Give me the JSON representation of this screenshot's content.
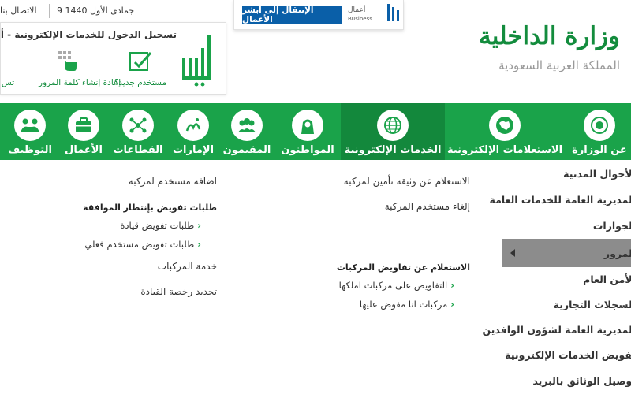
{
  "topbar": {
    "contact": "الاتصال بنا",
    "hijri_date": "9 جمادى الأول 1440"
  },
  "business": {
    "button_label": "الإنتقال إلى أبشر الأعمال",
    "logo_text": "أعمال",
    "logo_sub": "Business"
  },
  "login": {
    "title": "تسجيل الدخول للخدمات الإلكترونية - أبشر",
    "new_user": "مستخدم جديد؟",
    "reset_password": "إعادة إنشاء كلمة المرور",
    "other": "تس"
  },
  "ministry": {
    "name": "وزارة الداخلية",
    "sub": "المملكة العربية السعودية"
  },
  "nav": {
    "items": [
      {
        "label": "عن الوزارة",
        "icon": "emblem-icon"
      },
      {
        "label": "الاستعلامات الإلكترونية",
        "icon": "globe-map-icon"
      },
      {
        "label": "الخدمات الإلكترونية",
        "icon": "globe-icon",
        "active": true
      },
      {
        "label": "المواطنون",
        "icon": "citizen-icon"
      },
      {
        "label": "المقيمون",
        "icon": "residents-icon"
      },
      {
        "label": "الإمارات",
        "icon": "emirates-icon"
      },
      {
        "label": "القطاعات",
        "icon": "sectors-icon"
      },
      {
        "label": "الأعمال",
        "icon": "briefcase-icon"
      },
      {
        "label": "التوظيف",
        "icon": "handshake-icon"
      }
    ]
  },
  "dropdown": {
    "col_middle": {
      "link1": "الاستعلام عن وثيقة تأمين لمركبة",
      "link2": "إلغاء مستخدم المركبة",
      "heading": "الاستعلام عن تفاويض المركبات",
      "sub1": "التفاويض على مركبات املكها",
      "sub2": "مركبات انا مفوض عليها"
    },
    "col_left": {
      "link1": "اضافة مستخدم لمركبة",
      "heading": "طلبات تفويض بإنتظار الموافقة",
      "sub1": "طلبات تفويض قيادة",
      "sub2": "طلبات تفويض مستخدم فعلي",
      "link2": "خدمة المركبات",
      "link3": "تجديد رخصة القيادة"
    }
  },
  "sidebar": {
    "items": [
      "الأحوال المدنية",
      "المديرية العامة للخدمات العامة",
      "الجوازات",
      "المرور",
      "الأمن العام",
      "السجلات التجارية",
      "المديرية العامة لشؤون الوافدين",
      "تفويض الخدمات الإلكترونية",
      "توصيل الوثائق بالبريد"
    ]
  },
  "colors": {
    "brand_green": "#1aa34a",
    "active_green": "#13883c",
    "business_blue": "#0a5fa8",
    "sidebar_active": "#8c8c8c"
  }
}
